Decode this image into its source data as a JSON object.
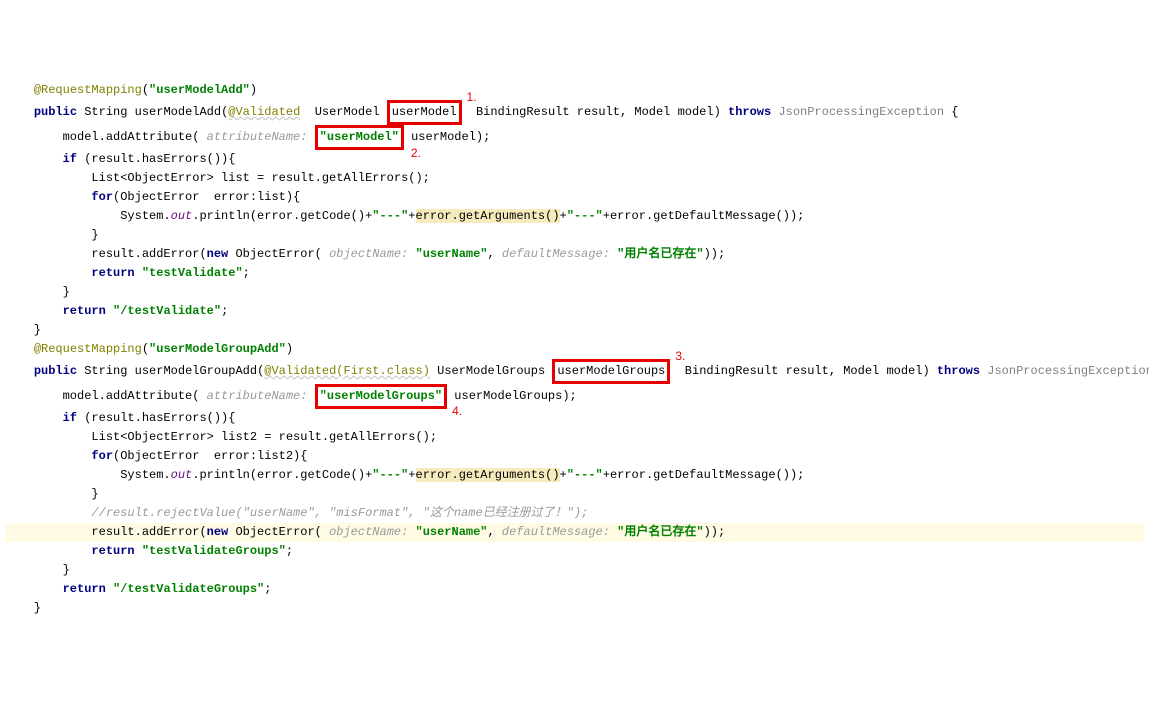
{
  "method1": {
    "annotation_request_mapping": "@RequestMapping",
    "mapping_value": "\"userModelAdd\"",
    "kw_public": "public",
    "kw_string": "String",
    "method_name": "userModelAdd",
    "validated": "@Validated",
    "usermodel_type": "UserModel",
    "usermodel_param": "userModel",
    "bindingresult": "BindingResult result,",
    "model_param": "Model model",
    "kw_throws": "throws",
    "exception": "JsonProcessingException",
    "addattr": "model.addAttribute(",
    "addattr_hint": "attributeName:",
    "addattr_name": "\"userModel\"",
    "addattr_var": "userModel",
    "kw_if": "if",
    "haserrors": "(result.hasErrors()){",
    "list_decl": "List<ObjectError> list = result.getAllErrors();",
    "kw_for": "for",
    "for_cond": "(ObjectError  error:list){",
    "sysout_pre": "System.",
    "out": "out",
    "println_getcode": ".println(error.getCode()+",
    "dash1": "\"---\"",
    "plus": "+",
    "getargs": "error.getArguments()",
    "dash2": "\"---\"",
    "getdefault": "error.getDefaultMessage());",
    "adderror": "result.addError(",
    "kw_new": "new",
    "objerror": "ObjectError(",
    "objname_hint": "objectName:",
    "objname_val": "\"userName\"",
    "defmsg_hint": "defaultMessage:",
    "defmsg_val": "\"用户名已存在\"",
    "kw_return": "return",
    "return1": "\"testValidate\"",
    "return2": "\"/testValidate\""
  },
  "method2": {
    "mapping_value": "\"userModelGroupAdd\"",
    "method_name": "userModelGroupAdd",
    "validated_first": "@Validated(First.class)",
    "usermodelgroups_type": "UserModelGroups",
    "usermodelgroups_param": "userModelGroups",
    "addattr_name": "\"userModelGroups\"",
    "addattr_var": "userModelGroups",
    "list_decl": "List<ObjectError> list2 = result.getAllErrors();",
    "for_cond": "(ObjectError  error:list2){",
    "comment": "//result.rejectValue(\"userName\", \"misFormat\", \"这个name已经注册过了！\");",
    "return1": "\"testValidateGroups\"",
    "return2": "\"/testValidateGroups\""
  },
  "labels": {
    "l1": "1.",
    "l2": "2.",
    "l3": "3.",
    "l4": "4."
  }
}
